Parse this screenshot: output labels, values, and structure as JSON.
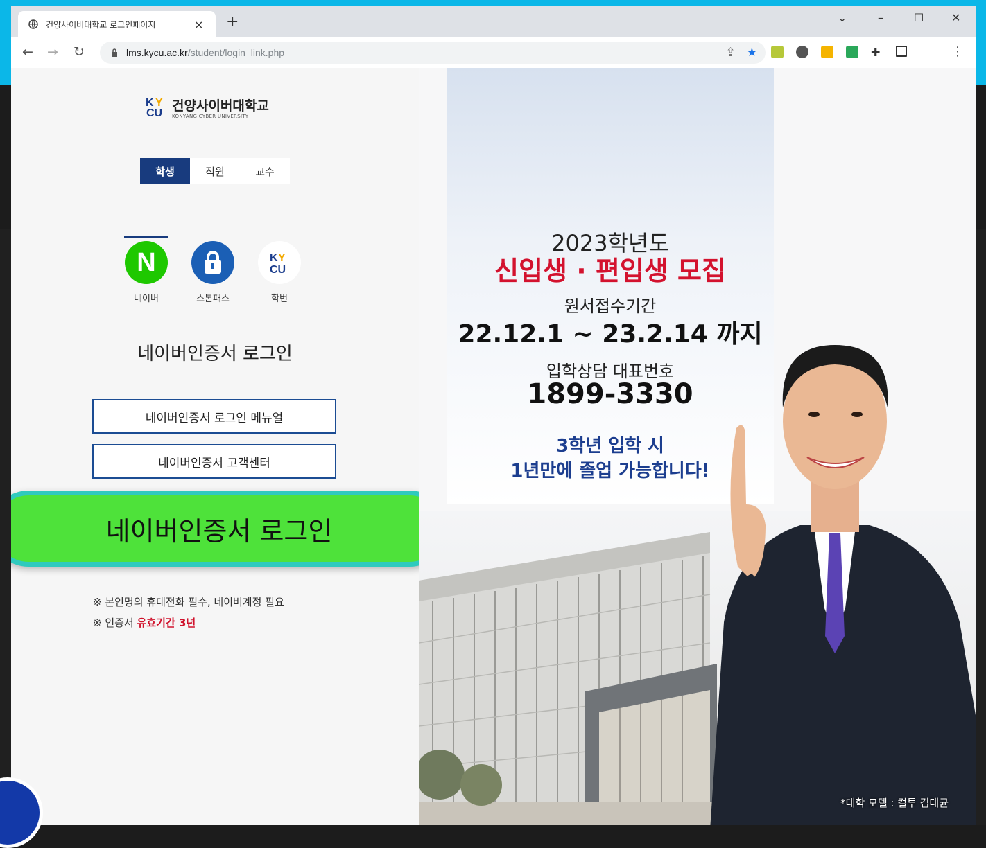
{
  "browser": {
    "tab_title": "건양사이버대학교 로그인페이지",
    "tab_close": "×",
    "new_tab": "+",
    "url_host": "lms.kycu.ac.kr",
    "url_path": "/student/login_link.php",
    "controls": {
      "dropdown": "⌄",
      "minimize": "–",
      "maximize": "☐",
      "close": "✕"
    },
    "nav": {
      "back": "←",
      "forward": "→",
      "reload": "↻"
    },
    "menu": "⋮"
  },
  "login": {
    "logo_ko": "건양사이버대학교",
    "logo_en": "KONYANG CYBER UNIVERSITY",
    "logo_k": "K",
    "logo_y": "Y",
    "logo_cu": "CU",
    "roles": [
      "학생",
      "직원",
      "교수"
    ],
    "methods": [
      {
        "label": "네이버",
        "icon": "naver-icon",
        "glyph": "N",
        "color": "#1ec800"
      },
      {
        "label": "스톤패스",
        "icon": "stonepass-lock-icon",
        "color": "#1b5fb5"
      },
      {
        "label": "학번",
        "icon": "kycu-logo-icon",
        "color": "#ffffff"
      }
    ],
    "section_title": "네이버인증서 로그인",
    "manual_button": "네이버인증서 로그인 메뉴얼",
    "support_button": "네이버인증서 고객센터",
    "login_button": "네이버인증서 로그인",
    "note1": "※ 본인명의 휴대전화 필수, 네이버계정 필요",
    "note2_prefix": "※ 인증서 ",
    "note2_highlight": "유효기간 3년"
  },
  "ad": {
    "year": "2023학년도",
    "recruit": "신입생 · 편입생 모집",
    "period_label": "원서접수기간",
    "period": "22.12.1 ~ 23.2.14 까지",
    "phone_label": "입학상담 대표번호",
    "phone": "1899-3330",
    "promo_line1": "3학년 입학 시",
    "promo_line2": "1년만에 졸업 가능합니다!",
    "caption": "*대학 모델 : 컬투 김태균"
  },
  "colors": {
    "accent": "#183b7e",
    "highlight": "#d3122e",
    "login_green": "#4ee23a",
    "screenshot_frame": "#0bb7e8"
  }
}
